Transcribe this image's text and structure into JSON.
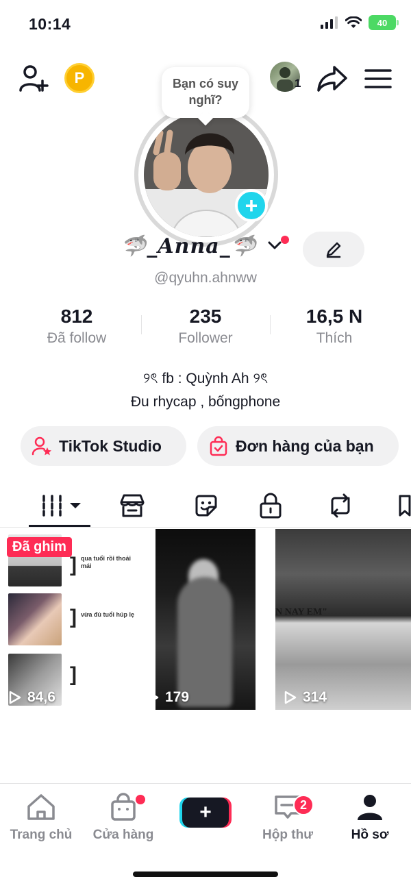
{
  "status_bar": {
    "time": "10:14",
    "battery": "40"
  },
  "top_nav": {
    "coin_label": "P",
    "friends_count": "1"
  },
  "profile": {
    "bubble_text": "Bạn có suy nghĩ?",
    "display_name": "🦈_𝑨𝒏𝒏𝒂_🦈",
    "username": "@qyuhn.ahnww",
    "stats": [
      {
        "value": "812",
        "label": "Đã follow"
      },
      {
        "value": "235",
        "label": "Follower"
      },
      {
        "value": "16,5 N",
        "label": "Thích"
      }
    ],
    "bio_line1": "୨ৎ fb : Quỳnh Ah ୨ৎ",
    "bio_line2": "Đu rhycap , bốngphone"
  },
  "actions": {
    "studio_label": "TikTok Studio",
    "orders_label": "Đơn hàng của bạn"
  },
  "videos": [
    {
      "pinned_label": "Đã ghim",
      "views": "84,6",
      "captions": [
        "qua tuổi rồi thoải mái",
        "vừa đủ tuổi húp lẹ"
      ]
    },
    {
      "views": "179"
    },
    {
      "views": "314",
      "caption": "N NAY EM\""
    }
  ],
  "bottom_nav": {
    "home": "Trang chủ",
    "shop": "Cửa hàng",
    "inbox": "Hộp thư",
    "inbox_badge": "2",
    "profile": "Hồ sơ"
  },
  "colors": {
    "accent_red": "#fe2c55",
    "accent_cyan": "#20d5ec",
    "text_primary": "#161823",
    "text_secondary": "#8a8b91",
    "coin": "#f7b500",
    "battery": "#4cd964"
  }
}
